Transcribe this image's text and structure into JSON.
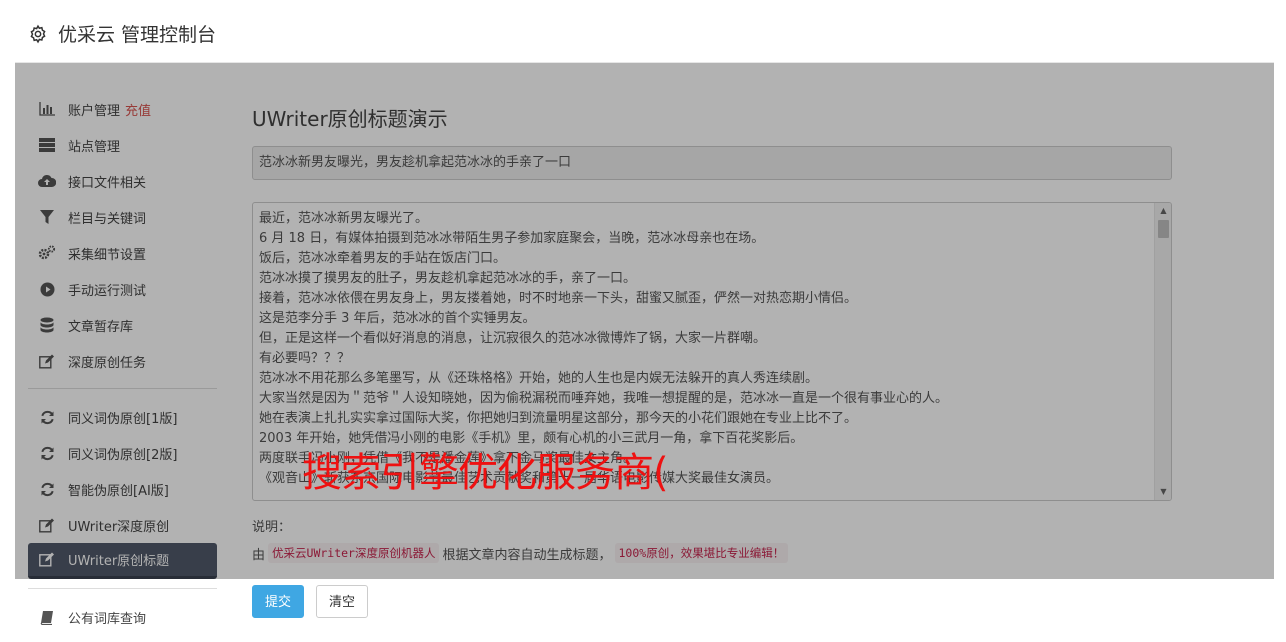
{
  "header": {
    "title": "优采云 管理控制台",
    "icon": "gear-icon"
  },
  "sidebar": {
    "items": [
      {
        "label": "账户管理",
        "extra": "充值",
        "icon": "bar-chart-icon"
      },
      {
        "label": "站点管理",
        "icon": "server-icon"
      },
      {
        "label": "接口文件相关",
        "icon": "cloud-upload-icon"
      },
      {
        "label": "栏目与关键词",
        "icon": "filter-icon"
      },
      {
        "label": "采集细节设置",
        "icon": "cogs-icon"
      },
      {
        "label": "手动运行测试",
        "icon": "play-circle-icon"
      },
      {
        "label": "文章暂存库",
        "icon": "database-icon"
      },
      {
        "label": "深度原创任务",
        "icon": "edit-icon"
      },
      {
        "label": "同义词伪原创[1版]",
        "icon": "refresh-icon"
      },
      {
        "label": "同义词伪原创[2版]",
        "icon": "refresh-icon"
      },
      {
        "label": "智能伪原创[AI版]",
        "icon": "refresh-icon"
      },
      {
        "label": "UWriter深度原创",
        "icon": "edit-icon"
      },
      {
        "label": "UWriter原创标题",
        "icon": "edit-icon"
      },
      {
        "label": "公有词库查询",
        "icon": "book-icon"
      }
    ]
  },
  "main": {
    "page_title": "UWriter原创标题演示",
    "title_value": "范冰冰新男友曝光，男友趁机拿起范冰冰的手亲了一口",
    "article_lines": [
      "最近，范冰冰新男友曝光了。",
      "6 月 18 日，有媒体拍摄到范冰冰带陌生男子参加家庭聚会，当晚，范冰冰母亲也在场。",
      "饭后，范冰冰牵着男友的手站在饭店门口。",
      "范冰冰摸了摸男友的肚子，男友趁机拿起范冰冰的手，亲了一口。",
      "接着，范冰冰依偎在男友身上，男友搂着她，时不时地亲一下头，甜蜜又腻歪，俨然一对热恋期小情侣。",
      "这是范李分手 3 年后，范冰冰的首个实锤男友。",
      "但，正是这样一个看似好消息的消息，让沉寂很久的范冰冰微博炸了锅，大家一片群嘲。",
      "有必要吗？？？",
      "范冰冰不用花那么多笔墨写，从《还珠格格》开始，她的人生也是内娱无法躲开的真人秀连续剧。",
      "大家当然是因为＂范爷＂人设知晓她，因为偷税漏税而唾弃她，我唯一想提醒的是，范冰冰一直是一个很有事业心的人。",
      "她在表演上扎扎实实拿过国际大奖，你把她归到流量明星这部分，那今天的小花们跟她在专业上比不了。",
      "2003 年开始，她凭借冯小刚的电影《手机》里，颇有心机的小三武月一角，拿下百花奖影后。",
      "两度联手冯小刚，凭借《我不是潘金莲》拿下金马奖最佳女主角。",
      "《观音山》斩获东京国际电影节最佳艺术贡献奖和第十一届华语电影传媒大奖最佳女演员。"
    ],
    "desc_label": "说明：",
    "desc_prefix": "由",
    "desc_code1": "优采云UWriter深度原创机器人",
    "desc_middle": "根据文章内容自动生成标题，",
    "desc_code2": "100%原创，效果堪比专业编辑！",
    "submit_label": "提交",
    "clear_label": "清空"
  },
  "watermark": {
    "text": "搜索引擎优化服务商(",
    "color": "#ee1111"
  },
  "colors": {
    "active_nav": "#515a6a",
    "primary_button": "#3fa7e3",
    "recharge": "#d9534f",
    "code_text": "#c7254e"
  }
}
